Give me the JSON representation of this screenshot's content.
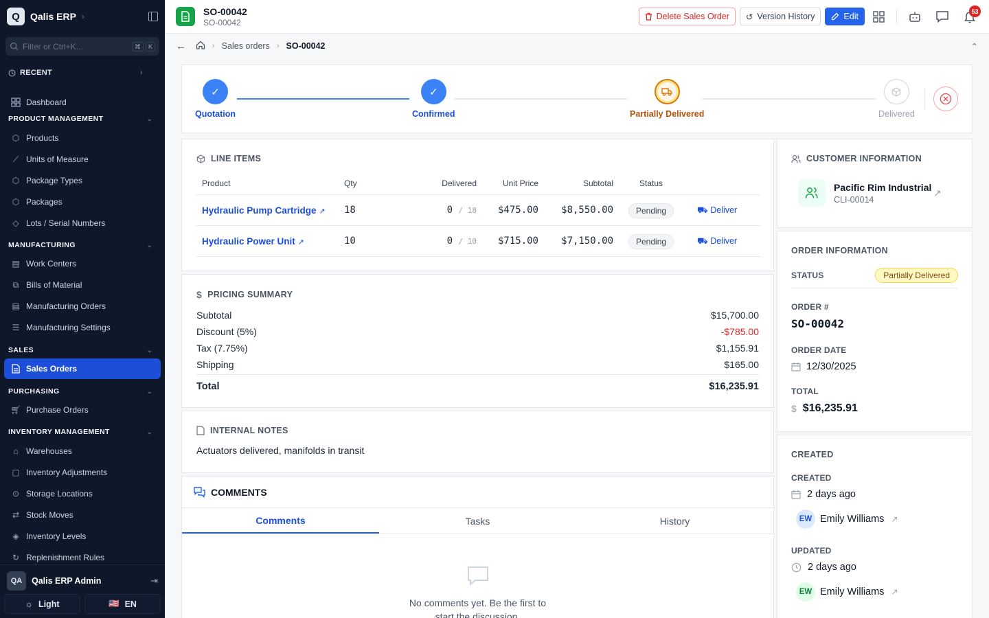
{
  "sidebar": {
    "brand": "Qalis ERP",
    "logo_letter": "Q",
    "filter_placeholder": "Filter or Ctrl+K...",
    "kbd": [
      "⌘",
      "K"
    ],
    "recent_label": "RECENT",
    "dashboard": "Dashboard",
    "sections": {
      "product": "PRODUCT MANAGEMENT",
      "manufacturing": "MANUFACTURING",
      "sales": "SALES",
      "purchasing": "PURCHASING",
      "inventory": "INVENTORY MANAGEMENT"
    },
    "product_items": [
      "Products",
      "Units of Measure",
      "Package Types",
      "Packages",
      "Lots / Serial Numbers"
    ],
    "manufacturing_items": [
      "Work Centers",
      "Bills of Material",
      "Manufacturing Orders",
      "Manufacturing Settings"
    ],
    "sales_items": [
      "Sales Orders"
    ],
    "purchasing_items": [
      "Purchase Orders"
    ],
    "inventory_items": [
      "Warehouses",
      "Inventory Adjustments",
      "Storage Locations",
      "Stock Moves",
      "Inventory Levels",
      "Replenishment Rules"
    ],
    "user_initials": "QA",
    "user_name": "Qalis ERP Admin",
    "theme_label": "Light",
    "lang_label": "EN",
    "flag": "🇺🇸"
  },
  "header": {
    "title": "SO-00042",
    "subtitle": "SO-00042",
    "delete_label": "Delete Sales Order",
    "version_label": "Version History",
    "edit_label": "Edit",
    "notif_count": "53"
  },
  "breadcrumb": {
    "item1": "Sales orders",
    "current": "SO-00042"
  },
  "stepper": {
    "steps": [
      "Quotation",
      "Confirmed",
      "Partially Delivered",
      "Delivered"
    ]
  },
  "line_items": {
    "title": "LINE ITEMS",
    "headers": [
      "Product",
      "Qty",
      "Delivered",
      "Unit Price",
      "Subtotal",
      "Status"
    ],
    "rows": [
      {
        "product": "Hydraulic Pump Cartridge",
        "qty": "18",
        "delivered": "0",
        "of": "/ 18",
        "unit_price": "$475.00",
        "subtotal": "$8,550.00",
        "status": "Pending",
        "action": "Deliver"
      },
      {
        "product": "Hydraulic Power Unit",
        "qty": "10",
        "delivered": "0",
        "of": "/ 10",
        "unit_price": "$715.00",
        "subtotal": "$7,150.00",
        "status": "Pending",
        "action": "Deliver"
      }
    ]
  },
  "pricing": {
    "title": "PRICING SUMMARY",
    "subtotal_label": "Subtotal",
    "subtotal": "$15,700.00",
    "discount_label": "Discount (5%)",
    "discount": "-$785.00",
    "tax_label": "Tax (7.75%)",
    "tax": "$1,155.91",
    "shipping_label": "Shipping",
    "shipping": "$165.00",
    "total_label": "Total",
    "total": "$16,235.91"
  },
  "notes": {
    "title": "INTERNAL NOTES",
    "text": "Actuators delivered, manifolds in transit"
  },
  "comments": {
    "title": "COMMENTS",
    "tabs": [
      "Comments",
      "Tasks",
      "History"
    ],
    "empty_line1": "No comments yet. Be the first to",
    "empty_line2": "start the discussion."
  },
  "customer": {
    "title": "CUSTOMER INFORMATION",
    "name": "Pacific Rim Industrial",
    "code": "CLI-00014"
  },
  "order_info": {
    "title": "ORDER INFORMATION",
    "status_label": "STATUS",
    "status": "Partially Delivered",
    "order_no_label": "ORDER #",
    "order_no": "SO-00042",
    "date_label": "ORDER DATE",
    "date": "12/30/2025",
    "total_label": "TOTAL",
    "total": "$16,235.91"
  },
  "created": {
    "title": "CREATED",
    "created_label": "CREATED",
    "created_when": "2 days ago",
    "created_by_initials": "EW",
    "created_by": "Emily Williams",
    "updated_label": "UPDATED",
    "updated_when": "2 days ago",
    "updated_by_initials": "EW",
    "updated_by": "Emily Williams"
  },
  "colors": {
    "accent": "#2563eb",
    "sidebar_bg": "#0f172a",
    "success": "#16a34a",
    "danger": "#dc2626",
    "warning": "#d97706"
  }
}
